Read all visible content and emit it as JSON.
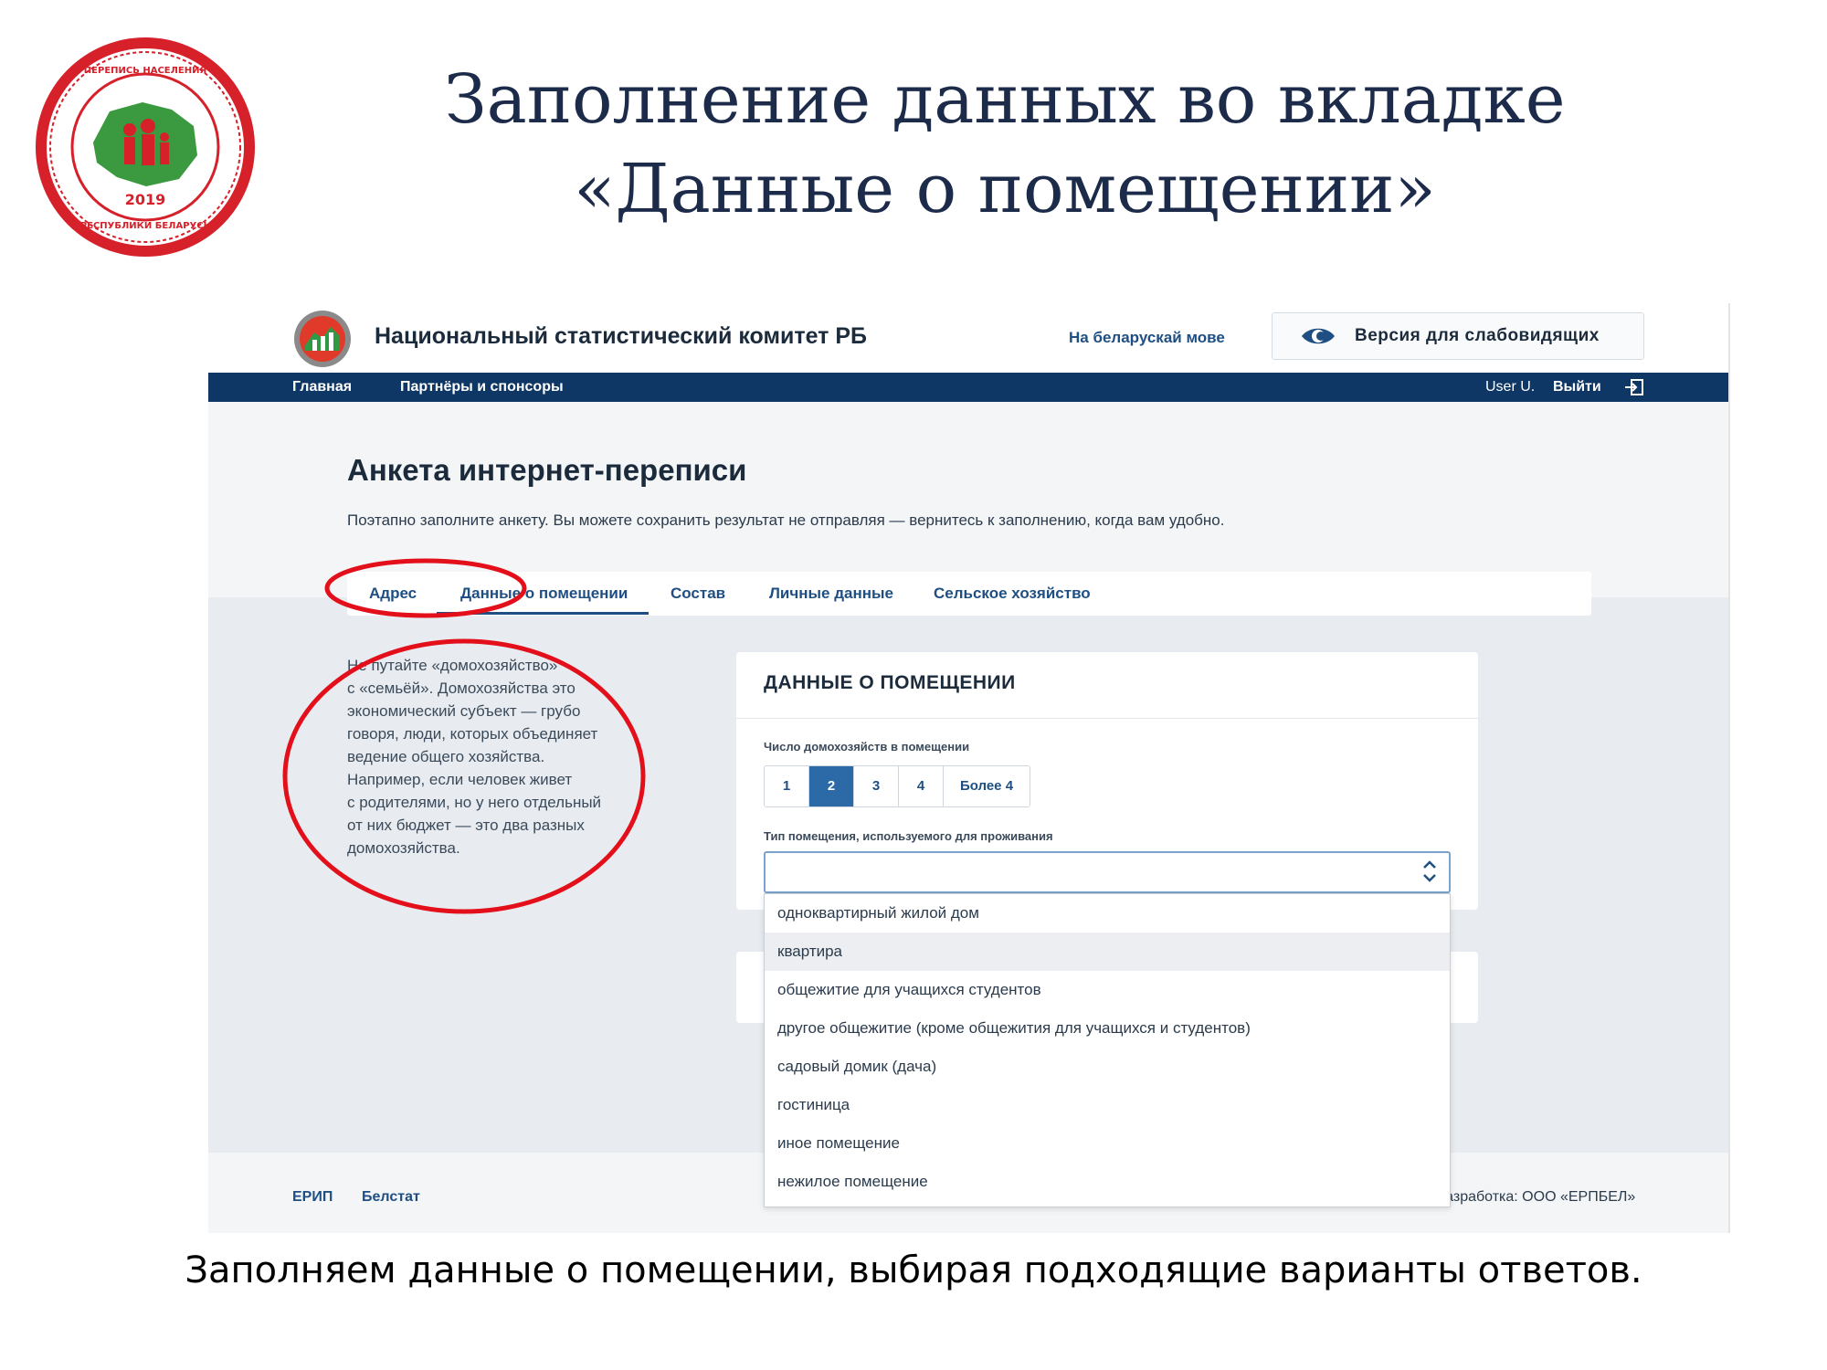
{
  "slide": {
    "title_line1": "Заполнение данных во вкладке",
    "title_line2": "«Данные о помещении»",
    "caption": "Заполняем данные о помещении, выбирая подходящие варианты ответов.",
    "logo_text_top": "ПЕРЕПИСЬ НАСЕЛЕНИЯ",
    "logo_year": "2019",
    "logo_text_bottom": "РЕСПУБЛИКИ БЕЛАРУСЬ",
    "highlight_color": "#e3101b"
  },
  "site": {
    "name": "Национальный статистический комитет РБ",
    "lang_link": "На беларускай мове",
    "low_vision_label": "Версия для слабовидящих",
    "brand_color": "#0f3765"
  },
  "nav": {
    "home": "Главная",
    "partners": "Партнёры и спонсоры",
    "user": "User U.",
    "logout": "Выйти"
  },
  "form": {
    "title": "Анкета интернет-переписи",
    "subtitle": "Поэтапно заполните анкету. Вы можете сохранить результат не отправляя — вернитесь к заполнению, когда вам удобно."
  },
  "tabs": [
    {
      "label": "Адрес"
    },
    {
      "label": "Данные о помещении",
      "active": true
    },
    {
      "label": "Состав"
    },
    {
      "label": "Личные данные"
    },
    {
      "label": "Сельское хозяйство"
    }
  ],
  "hint": {
    "lines": [
      "Не путайте «домохозяйство»",
      "с «семьёй». Домохозяйства это",
      "экономический субъект — грубо",
      "говоря, люди, которых объединяет",
      "ведение общего хозяйства.",
      "Например, если человек живет",
      "с родителями, но у него отдельный",
      "от них бюджет — это два разных",
      "домохозяйства."
    ]
  },
  "card": {
    "title": "ДАННЫЕ О ПОМЕЩЕНИИ",
    "households_label": "Число домохозяйств в помещении",
    "households_options": [
      "1",
      "2",
      "3",
      "4",
      "Более 4"
    ],
    "households_selected": "2",
    "dwelling_type_label": "Тип помещения, используемого для проживания",
    "dwelling_type_value": ""
  },
  "dropdown": {
    "options": [
      "одноквартирный жилой дом",
      "квартира",
      "общежитие для учащихся студентов",
      "другое общежитие (кроме общежития для учащихся и студентов)",
      "садовый домик (дача)",
      "гостиница",
      "иное помещение",
      "нежилое помещение"
    ],
    "hovered": "квартира"
  },
  "footer": {
    "link1": "ЕРИП",
    "link2": "Белстат",
    "developer": "Разработка: ООО «ЕРПБЕЛ»"
  }
}
